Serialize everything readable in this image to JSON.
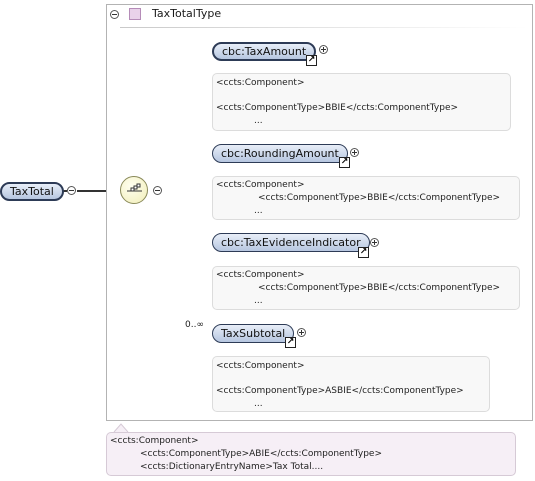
{
  "root_element": {
    "label": "TaxTotal"
  },
  "type": {
    "label": "TaxTotalType"
  },
  "children": [
    {
      "label": "cbc:TaxAmount",
      "doc": [
        "<ccts:Component>",
        "<ccts:ComponentType>BBIE</ccts:ComponentType>",
        "..."
      ]
    },
    {
      "label": "cbc:RoundingAmount",
      "doc": [
        "<ccts:Component>",
        "<ccts:ComponentType>BBIE</ccts:ComponentType>",
        "..."
      ]
    },
    {
      "label": "cbc:TaxEvidenceIndicator",
      "doc": [
        "<ccts:Component>",
        "<ccts:ComponentType>BBIE</ccts:ComponentType>",
        "..."
      ]
    },
    {
      "label": "TaxSubtotal",
      "cardinality": "0..∞",
      "doc": [
        "<ccts:Component>",
        "<ccts:ComponentType>ASBIE</ccts:ComponentType>",
        "..."
      ]
    }
  ],
  "main_doc": [
    "<ccts:Component>",
    "<ccts:ComponentType>ABIE</ccts:ComponentType>",
    "<ccts:DictionaryEntryName>Tax Total...."
  ],
  "icons": {
    "link": "↗"
  }
}
